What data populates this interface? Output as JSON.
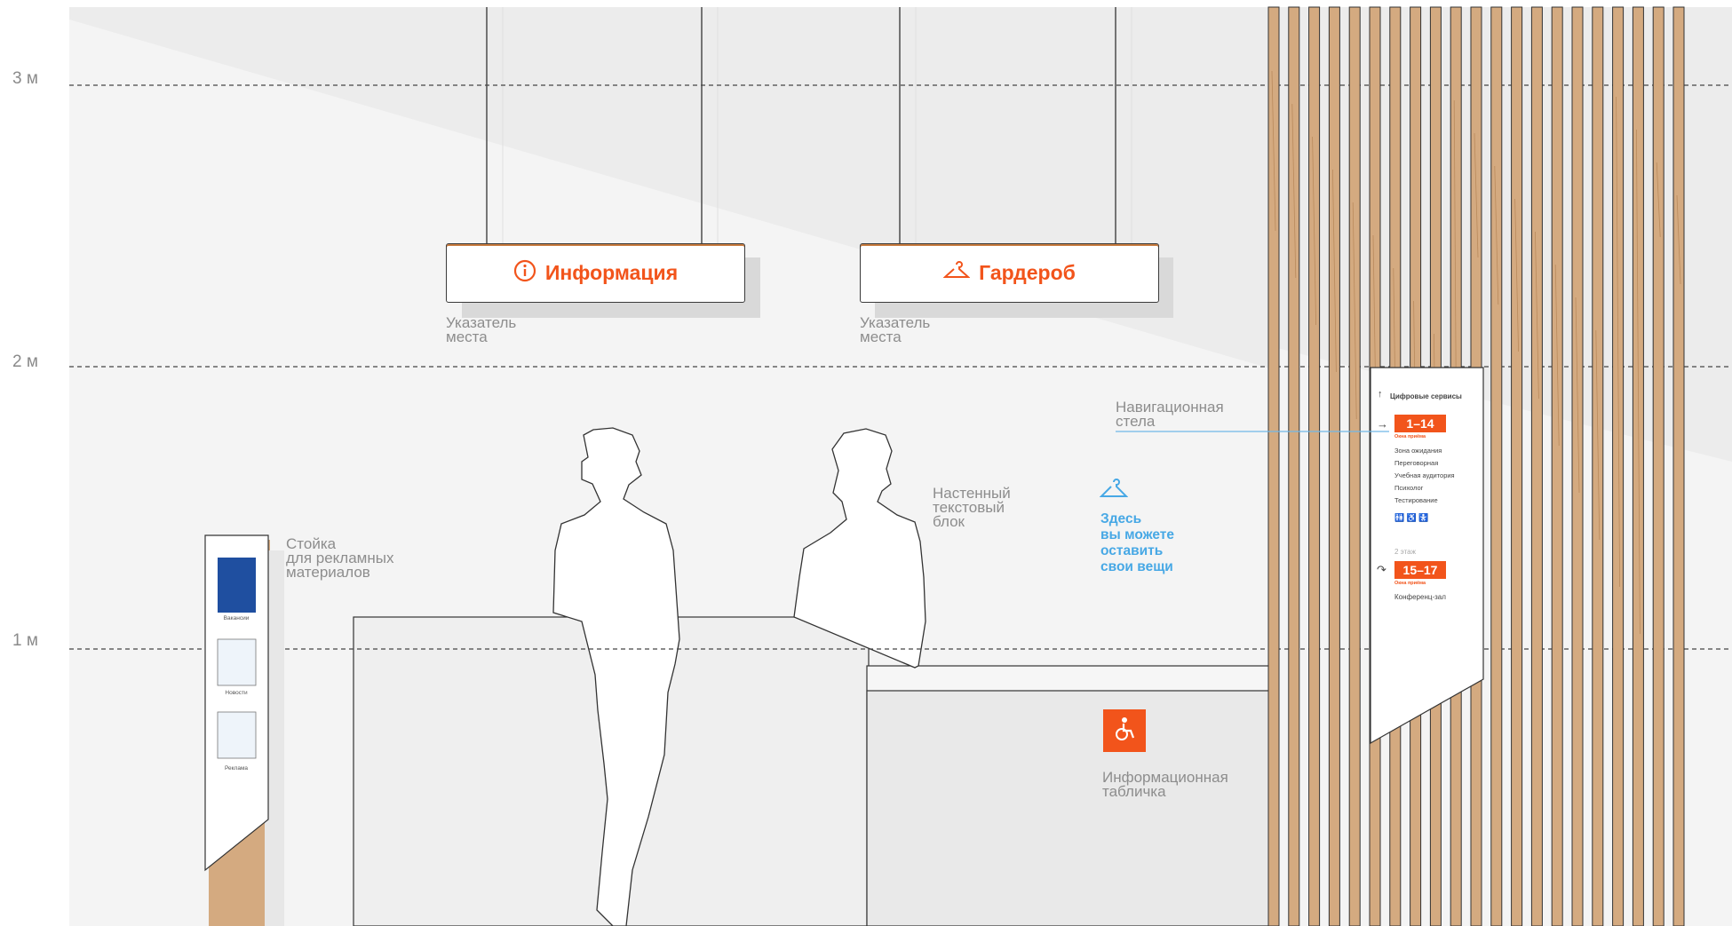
{
  "heights": {
    "h3": "3 м",
    "h2": "2 м",
    "h1": "1 м"
  },
  "signs": {
    "info": {
      "label": "Информация",
      "icon": "info-icon"
    },
    "wardrobe": {
      "label": "Гардероб",
      "icon": "hanger-icon"
    }
  },
  "captions": {
    "place_pointer_1": "Указатель\nместа",
    "place_pointer_2": "Указатель\nместа",
    "nav_stele": "Навигационная\nстела",
    "wall_text_block": "Настенный\nтекстовый\nблок",
    "ad_stand": "Стойка\nдля рекламных\nматериалов",
    "info_plate": "Информационная\nтабличка"
  },
  "wall_block": {
    "text": "Здесь\nвы можете\nоставить\nсвои вещи",
    "icon": "hanger-icon"
  },
  "stele": {
    "header": "Цифровые сервисы",
    "badge1": "1–14",
    "badge1_sub": "Окна приёма",
    "list": [
      "Зона ожидания",
      "Переговорная",
      "Учебная аудитория",
      "Психолог",
      "Тестирование"
    ],
    "floor": "2 этаж",
    "badge2": "15–17",
    "badge2_sub": "Окна приёма",
    "conf": "Конференц-зал"
  },
  "stand": {
    "items": [
      "Вакансии",
      "Новости",
      "Реклама"
    ]
  },
  "colors": {
    "accent": "#f2541b",
    "blue_text": "#47a8e5",
    "wood": "#d4aa80",
    "wall": "#f3f3f3"
  }
}
